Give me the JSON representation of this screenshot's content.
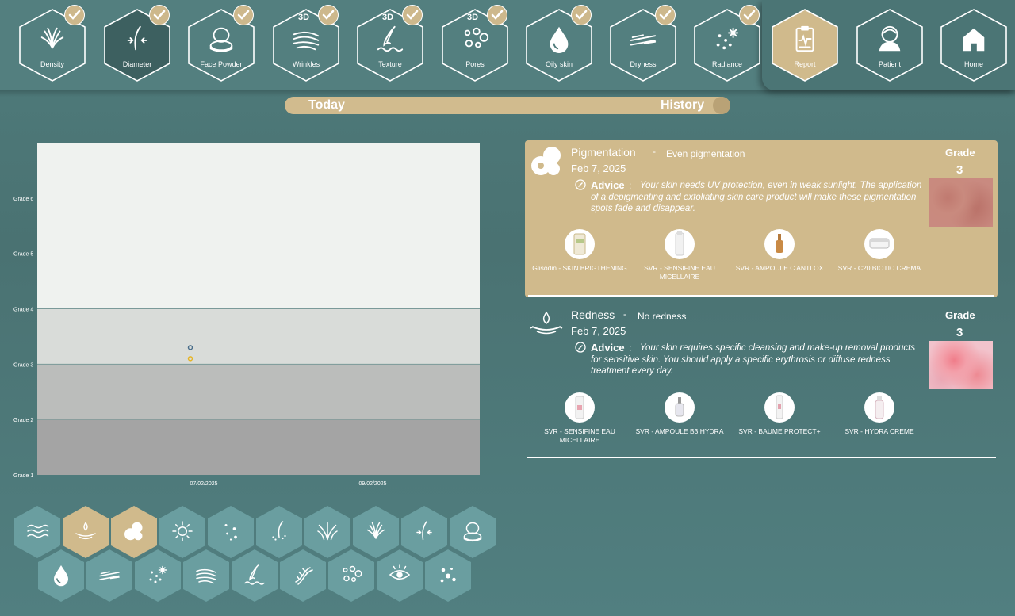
{
  "nav": {
    "items": [
      {
        "label": "Density",
        "icon": "grass-icon",
        "checked": true,
        "tag": ""
      },
      {
        "label": "Diameter",
        "icon": "hair-diameter-icon",
        "checked": true,
        "tag": "",
        "active": true
      },
      {
        "label": "Face Powder",
        "icon": "compact-powder-icon",
        "checked": true,
        "tag": ""
      },
      {
        "label": "Wrinkles",
        "icon": "wrinkles-icon",
        "checked": true,
        "tag": "3D"
      },
      {
        "label": "Texture",
        "icon": "texture-icon",
        "checked": true,
        "tag": "3D"
      },
      {
        "label": "Pores",
        "icon": "pores-icon",
        "checked": true,
        "tag": "3D"
      },
      {
        "label": "Oily skin",
        "icon": "oil-drop-icon",
        "checked": true,
        "tag": ""
      },
      {
        "label": "Dryness",
        "icon": "dryness-icon",
        "checked": true,
        "tag": ""
      },
      {
        "label": "Radiance",
        "icon": "radiance-icon",
        "checked": true,
        "tag": ""
      },
      {
        "label": "Report",
        "icon": "report-clipboard-icon",
        "checked": false,
        "tag": "",
        "selected": true
      },
      {
        "label": "Patient",
        "icon": "patient-icon",
        "checked": false,
        "tag": ""
      },
      {
        "label": "Home",
        "icon": "home-icon",
        "checked": false,
        "tag": ""
      }
    ]
  },
  "toggle": {
    "today": "Today",
    "history": "History"
  },
  "chart_data": {
    "type": "scatter",
    "y_categories": [
      "Grade 1",
      "Grade 2",
      "Grade 3",
      "Grade 4",
      "Grade 5",
      "Grade 6"
    ],
    "x_ticks": [
      "07/02/2025",
      "09/02/2025"
    ],
    "series": [
      {
        "color": "#4a6e8a",
        "points": [
          {
            "x": "07/02/2025",
            "y": 3.3
          }
        ]
      },
      {
        "color": "#e6b422",
        "points": [
          {
            "x": "07/02/2025",
            "y": 3.1
          }
        ]
      }
    ],
    "bands": [
      {
        "from": 1,
        "to": 2,
        "color": "#a4a4a4"
      },
      {
        "from": 2,
        "to": 3,
        "color": "#bbbdbb"
      },
      {
        "from": 3,
        "to": 4,
        "color": "#d9dcd9"
      },
      {
        "from": 4,
        "to": 7,
        "color": "#eff2ef"
      }
    ]
  },
  "cards": [
    {
      "title": "Pigmentation",
      "dash": "-",
      "subtitle": "Even pigmentation",
      "date": "Feb 7, 2025",
      "grade_label": "Grade",
      "grade": "3",
      "advice_label": "Advice",
      "advice_sep": ":",
      "advice": "Your skin needs UV protection, even in weak sunlight. The application of a depigmenting and exfoliating skin care product will make these pigmentation spots fade and disappear.",
      "products": [
        "Glisodin  -  SKIN BRIGTHENING",
        "SVR  -  SENSIFINE EAU MICELLAIRE",
        "SVR  -  AMPOULE C ANTI OX",
        "SVR  -  C20 BIOTIC CREMA"
      ]
    },
    {
      "title": "Redness",
      "dash": "-",
      "subtitle": "No redness",
      "date": "Feb 7, 2025",
      "grade_label": "Grade",
      "grade": "3",
      "advice_label": "Advice",
      "advice_sep": ":",
      "advice": "Your skin requires specific cleansing and make-up removal products for sensitive skin. You should apply a specific erythrosis or diffuse redness treatment every day.",
      "products": [
        "SVR  -  SENSIFINE EAU MICELLAIRE",
        "SVR  -  AMPOULE B3 HYDRA",
        "SVR  -  BAUME PROTECT+",
        "SVR  -  HYDRA CREME"
      ]
    }
  ],
  "bottom_icons": [
    {
      "icon": "waves-icon",
      "active": false
    },
    {
      "icon": "redness-icon",
      "active": true
    },
    {
      "icon": "pigmentation-icon",
      "active": true
    },
    {
      "icon": "sun-icon",
      "active": false
    },
    {
      "icon": "spots-icon",
      "active": false
    },
    {
      "icon": "hair-loss-icon",
      "active": false
    },
    {
      "icon": "hair-volume-icon",
      "active": false
    },
    {
      "icon": "grass-icon",
      "active": false
    },
    {
      "icon": "hair-diameter-icon",
      "active": false
    },
    {
      "icon": "compact-powder-icon",
      "active": false
    },
    {
      "icon": "oil-drop-icon",
      "active": false
    },
    {
      "icon": "dryness-icon",
      "active": false
    },
    {
      "icon": "radiance-icon",
      "active": false
    },
    {
      "icon": "wrinkles-icon",
      "active": false
    },
    {
      "icon": "texture-icon",
      "active": false
    },
    {
      "icon": "dna-icon",
      "active": false
    },
    {
      "icon": "pores-icon",
      "active": false
    },
    {
      "icon": "eye-icon",
      "active": false
    },
    {
      "icon": "bubbles-icon",
      "active": false
    }
  ],
  "colors": {
    "accent": "#d0ba8c",
    "background": "#4e7a7a",
    "active_hex": "#3f6161"
  }
}
